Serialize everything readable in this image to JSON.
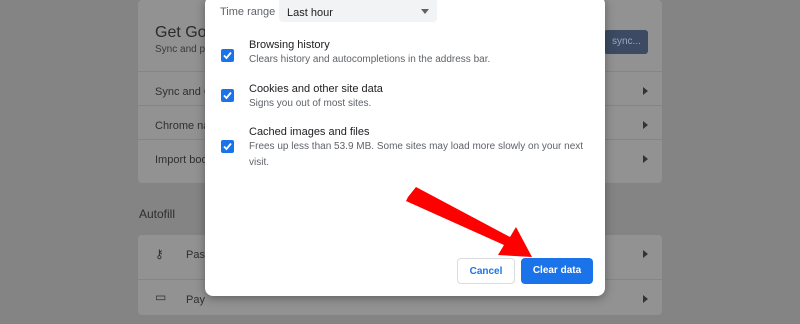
{
  "background": {
    "sync_card": {
      "title": "Get Goo",
      "subtitle": "Sync and p",
      "button_label": "sync..."
    },
    "rows": [
      {
        "label": "Sync and G"
      },
      {
        "label": "Chrome na"
      },
      {
        "label": "Import boo"
      }
    ],
    "autofill_title": "Autofill",
    "autofill_rows": [
      {
        "label": "Pas",
        "icon": "key-icon"
      },
      {
        "label": "Pay",
        "icon": "card-icon"
      }
    ]
  },
  "dialog": {
    "time_range": {
      "label": "Time range",
      "selected": "Last hour"
    },
    "options": [
      {
        "title": "Browsing history",
        "description": "Clears history and autocompletions in the address bar.",
        "checked": true
      },
      {
        "title": "Cookies and other site data",
        "description": "Signs you out of most sites.",
        "checked": true
      },
      {
        "title": "Cached images and files",
        "description": "Frees up less than 53.9 MB. Some sites may load more slowly on your next visit.",
        "checked": true
      }
    ],
    "buttons": {
      "cancel": "Cancel",
      "clear": "Clear data"
    }
  },
  "annotation": {
    "arrow_color": "#ff0000"
  },
  "colors": {
    "accent": "#1a73e8",
    "overlay": "#848484"
  }
}
